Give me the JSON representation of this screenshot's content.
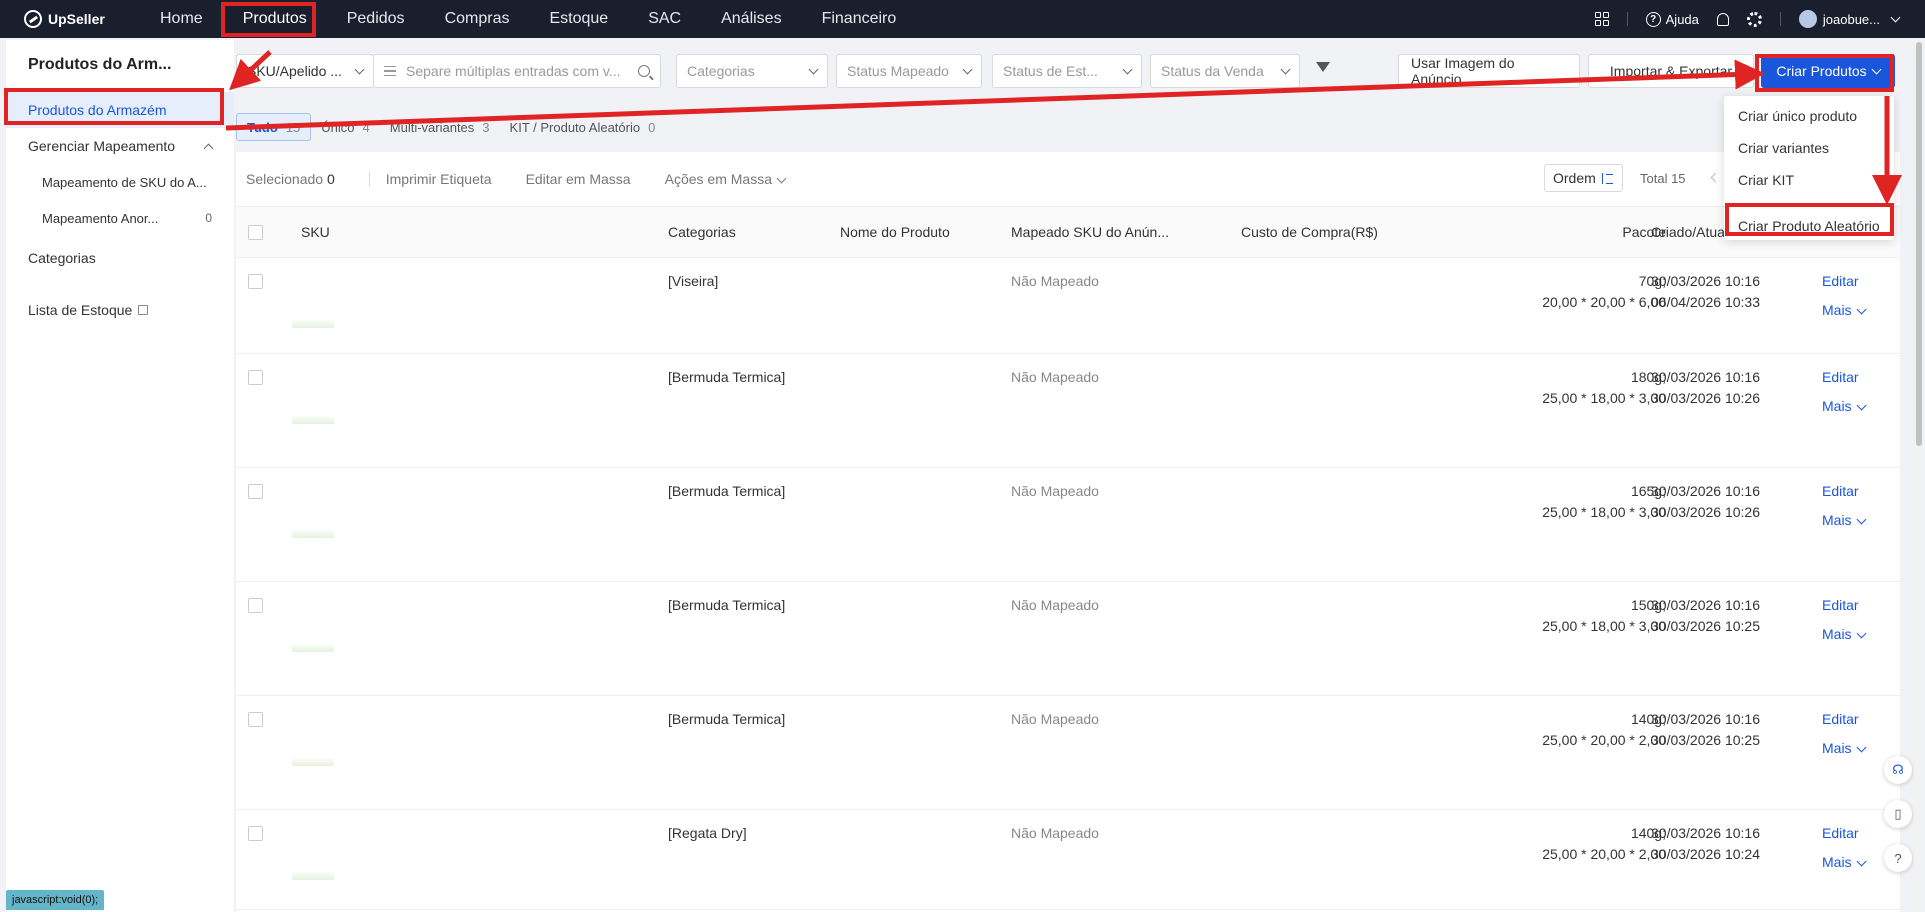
{
  "nav": {
    "logo": "UpSeller",
    "items": [
      "Home",
      "Produtos",
      "Pedidos",
      "Compras",
      "Estoque",
      "SAC",
      "Análises",
      "Financeiro"
    ],
    "help": "Ajuda",
    "user": "joaobue..."
  },
  "sidebar": {
    "title": "Produtos do Arm...",
    "items": [
      {
        "label": "Produtos do Armazém"
      },
      {
        "label": "Gerenciar Mapeamento"
      },
      {
        "label": "Mapeamento de SKU do A..."
      },
      {
        "label": "Mapeamento Anor...",
        "count": "0"
      },
      {
        "label": "Categorias"
      },
      {
        "label": "Lista de Estoque"
      }
    ]
  },
  "filters": {
    "sku_select": "SKU/Apelido ...",
    "search_placeholder": "Separe múltiplas entradas com v...",
    "categorias": "Categorias",
    "status_mapeado": "Status Mapeado",
    "status_estoque": "Status de Est...",
    "status_venda": "Status da Venda",
    "usar_imagem": "Usar Imagem do Anúncio",
    "importar": "Importar & Exportar",
    "criar": "Criar Produtos"
  },
  "tabs": [
    {
      "label": "Tudo",
      "count": "15"
    },
    {
      "label": "Único",
      "count": "4"
    },
    {
      "label": "Multi-variantes",
      "count": "3"
    },
    {
      "label": "KIT / Produto Aleatório",
      "count": "0"
    }
  ],
  "toolbar": {
    "selecionado": "Selecionado",
    "selecionado_count": "0",
    "imprimir": "Imprimir Etiqueta",
    "editar_massa": "Editar em Massa",
    "acoes_massa": "Ações em Massa",
    "ordem": "Ordem",
    "total": "Total 15"
  },
  "table": {
    "headers": {
      "sku": "SKU",
      "categorias": "Categorias",
      "nome": "Nome do Produto",
      "mapeado": "Mapeado SKU do Anún...",
      "custo": "Custo de Compra(R$)",
      "pacote": "Pacote",
      "criado": "Criado/Atua"
    },
    "rows": [
      {
        "categoria": "[Viseira]",
        "mapeado": "Não Mapeado",
        "peso": "70g;",
        "dim": "20,00 * 20,00 * 6,00",
        "criado": "30/03/2026 10:16",
        "atualizado": "06/04/2026 10:33"
      },
      {
        "categoria": "[Bermuda Termica]",
        "mapeado": "Não Mapeado",
        "peso": "180g;",
        "dim": "25,00 * 18,00 * 3,00",
        "criado": "30/03/2026 10:16",
        "atualizado": "30/03/2026 10:26"
      },
      {
        "categoria": "[Bermuda Termica]",
        "mapeado": "Não Mapeado",
        "peso": "165g;",
        "dim": "25,00 * 18,00 * 3,00",
        "criado": "30/03/2026 10:16",
        "atualizado": "30/03/2026 10:26"
      },
      {
        "categoria": "[Bermuda Termica]",
        "mapeado": "Não Mapeado",
        "peso": "150g;",
        "dim": "25,00 * 18,00 * 3,00",
        "criado": "30/03/2026 10:16",
        "atualizado": "30/03/2026 10:25"
      },
      {
        "categoria": "[Bermuda Termica]",
        "mapeado": "Não Mapeado",
        "peso": "140g;",
        "dim": "25,00 * 20,00 * 2,00",
        "criado": "30/03/2026 10:16",
        "atualizado": "30/03/2026 10:25"
      },
      {
        "categoria": "[Regata Dry]",
        "mapeado": "Não Mapeado",
        "peso": "140g;",
        "dim": "25,00 * 20,00 * 2,00",
        "criado": "30/03/2026 10:16",
        "atualizado": "30/03/2026 10:24"
      }
    ],
    "editar": "Editar",
    "mais": "Mais"
  },
  "dropdown": {
    "items": [
      "Criar único produto",
      "Criar variantes",
      "Criar KIT",
      "Criar Produto Aleatório"
    ]
  },
  "status_bar": "javascript:void(0);",
  "colors": {
    "accent": "#1a56db",
    "annotation": "#e02424",
    "nav_bg": "#1a1f2e"
  }
}
